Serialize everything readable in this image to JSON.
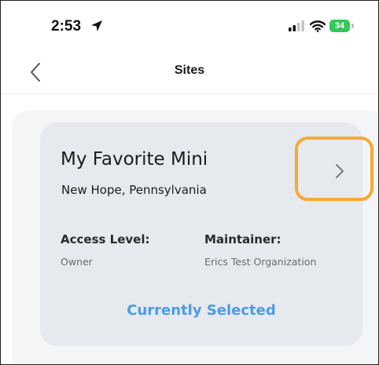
{
  "status_bar": {
    "time": "2:53",
    "battery": "34",
    "icons": [
      "location-arrow-icon",
      "signal-icon",
      "wifi-icon",
      "battery-icon"
    ],
    "battery_color": "#34c759"
  },
  "nav": {
    "title": "Sites",
    "back_icon": "chevron-left-icon"
  },
  "site_card": {
    "name": "My Favorite Mini",
    "location": "New Hope, Pennsylvania",
    "access_level_label": "Access Level:",
    "access_level_value": "Owner",
    "maintainer_label": "Maintainer:",
    "maintainer_value": "Erics Test Organization",
    "status": "Currently Selected",
    "detail_icon": "chevron-right-icon"
  },
  "colors": {
    "accent": "#4a9be6",
    "highlight": "#f7a935",
    "card_background": "#e6e9ee"
  }
}
